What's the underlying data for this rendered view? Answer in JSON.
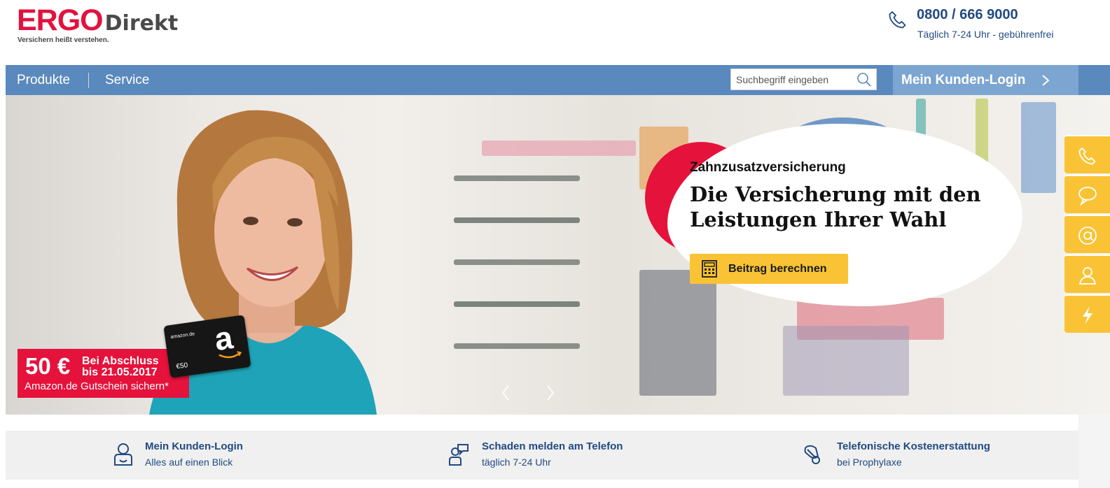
{
  "header": {
    "logo_main": "ERGO",
    "logo_sub": "Direkt",
    "tagline": "Versichern heißt verstehen.",
    "phone_number": "0800 / 666 9000",
    "phone_hours": "Täglich 7-24 Uhr - gebührenfrei",
    "phone_icon": "phone-icon"
  },
  "nav": {
    "items": [
      "Produkte",
      "Service"
    ],
    "search_placeholder": "Suchbegriff eingeben",
    "search_icon": "search-icon",
    "login_label": "Mein Kunden-Login",
    "login_icon": "chevron-right-icon"
  },
  "hero": {
    "kicker": "Zahnzusatzversicherung",
    "headline": "Die Versicherung mit den Leistungen Ihrer Wahl",
    "cta_label": "Beitrag berechnen",
    "cta_icon": "calculator-icon",
    "promo_amount": "50 €",
    "promo_line1": "Bei Abschluss",
    "promo_line2": "bis 21.05.2017",
    "promo_sub": "Amazon.de Gutschein sichern*",
    "giftcard_brand": "amazon.de",
    "giftcard_logo": "a",
    "giftcard_value": "€50",
    "arrow_prev_icon": "chevron-left-icon",
    "arrow_next_icon": "chevron-right-icon"
  },
  "sidetabs": [
    "phone-icon",
    "chat-bubble-icon",
    "at-sign-icon",
    "person-icon",
    "lightning-icon"
  ],
  "strip": [
    {
      "title": "Mein Kunden-Login",
      "subtitle": "Alles auf einen Blick",
      "icon": "user-icon"
    },
    {
      "title": "Schaden melden am Telefon",
      "subtitle": "täglich 7-24 Uhr",
      "icon": "support-chat-icon"
    },
    {
      "title": "Telefonische Kostenerstattung",
      "subtitle": "bei Prophylaxe",
      "icon": "tooth-icon"
    }
  ],
  "colors": {
    "brand_red": "#e2123f",
    "nav_blue": "#5a89bd",
    "login_blue": "#7ca5d1",
    "accent_yellow": "#f9c335",
    "text_blue": "#214a80"
  }
}
